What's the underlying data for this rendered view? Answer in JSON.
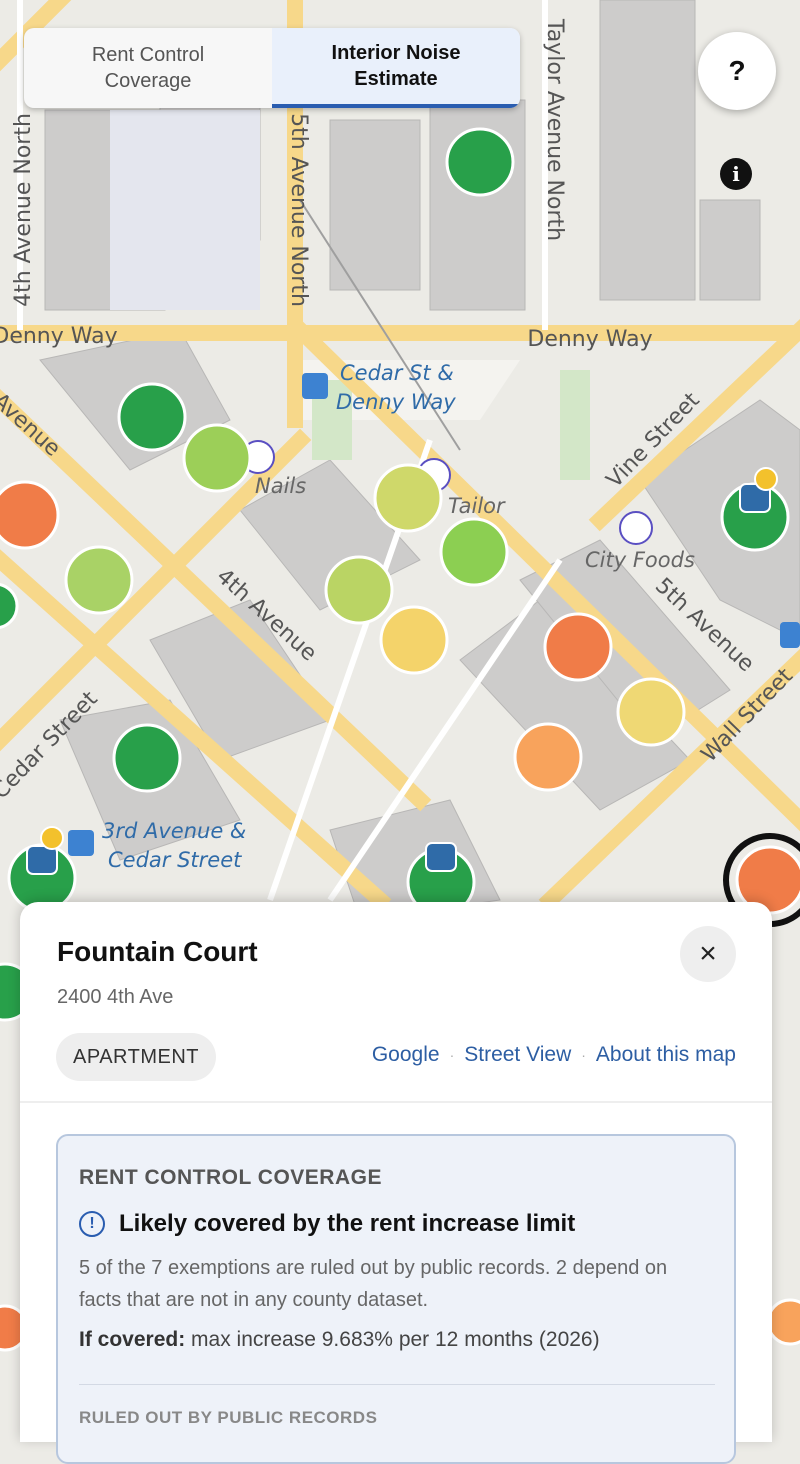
{
  "tabs": [
    {
      "label": "Rent Control\nCoverage",
      "active": false
    },
    {
      "label": "Interior Noise\nEstimate",
      "active": true
    }
  ],
  "help_label": "?",
  "info_label": "i",
  "map": {
    "streets": [
      "4th Avenue North",
      "5th Avenue North",
      "Taylor Avenue North",
      "Denny Way",
      "Denny Way",
      "4th Avenue",
      "5th Avenue",
      "Vine Street",
      "Wall Street",
      "Cedar Street",
      "Avenue"
    ],
    "places": [
      "Cedar St &",
      "Denny Way",
      "Nails",
      "Tailor",
      "City Foods",
      "3rd Avenue &",
      "Cedar Street"
    ],
    "colors": {
      "quiet": "#28a04a",
      "moderate": "#9ccf58",
      "mid": "#cfd86a",
      "yellow": "#f4d36a",
      "orange": "#f89a5a",
      "loud": "#f07c48"
    }
  },
  "sheet": {
    "title": "Fountain Court",
    "address": "2400 4th Ave",
    "type_chip": "APARTMENT",
    "links": [
      "Google",
      "Street View",
      "About this map"
    ],
    "close_label": "×",
    "card": {
      "heading": "RENT CONTROL COVERAGE",
      "status_icon": "!",
      "status": "Likely covered by the rent increase limit",
      "description": "5 of the 7 exemptions are ruled out by public records. 2 depend on facts that are not in any county dataset.",
      "max_label": "If covered:",
      "max_text": " max increase 9.683% per 12 months (2026)",
      "subheading": "RULED OUT BY PUBLIC RECORDS"
    }
  }
}
